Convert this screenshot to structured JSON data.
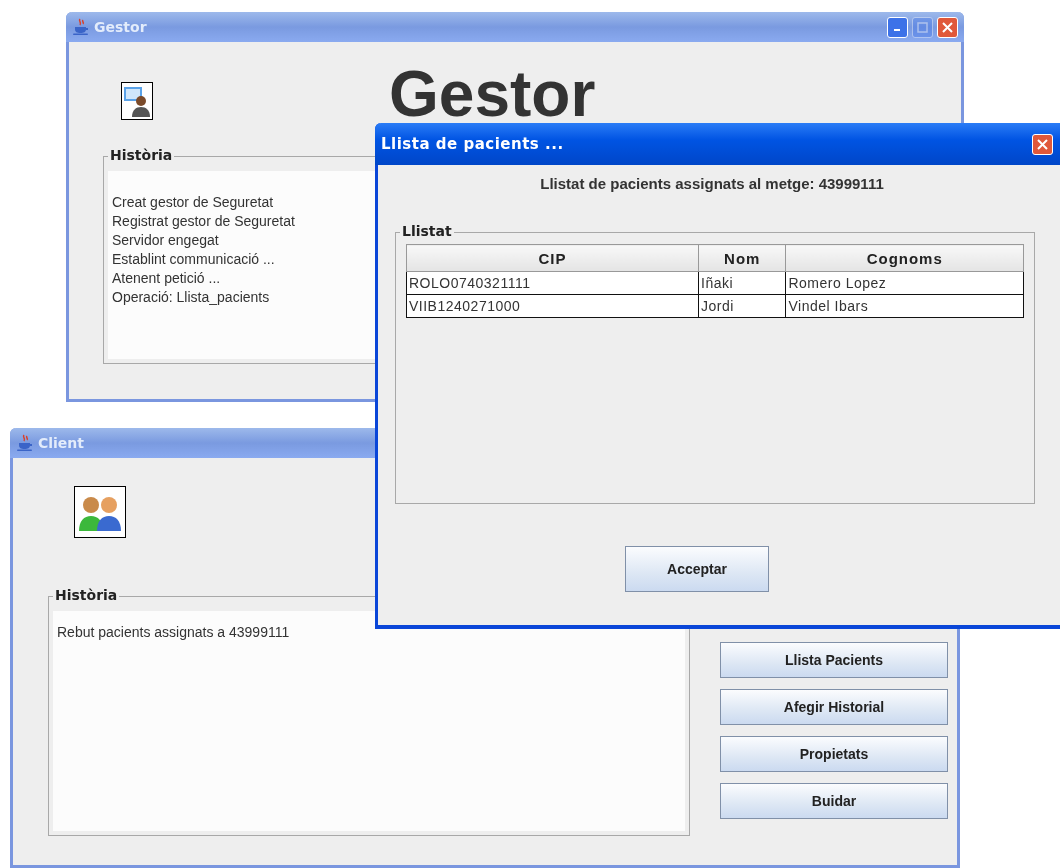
{
  "gestor_window": {
    "title": "Gestor",
    "active": false,
    "maximize_disabled": true,
    "heading": "Gestor",
    "history": {
      "label": "Història",
      "lines": [
        "Creat gestor de Seguretat",
        "Registrat gestor de Seguretat",
        "Servidor engegat",
        "Establint communicació ...",
        "Atenent petició ...",
        "Operació: Llista_pacients"
      ]
    }
  },
  "client_window": {
    "title": "Client",
    "active": false,
    "history": {
      "label": "Història",
      "lines": [
        "Rebut pacients assignats a 43999111"
      ]
    },
    "buttons": [
      "Llista Pacients",
      "Afegir Historial",
      "Propietats",
      "Buidar"
    ]
  },
  "dialog": {
    "title": "Llista de pacients ...",
    "active": true,
    "message": "Llistat de pacients assignats al metge: 43999111",
    "group_label": "Llistat",
    "table": {
      "columns": [
        "CIP",
        "Nom",
        "Cognoms"
      ],
      "rows": [
        [
          "ROLO0740321111",
          "Iñaki",
          "Romero Lopez"
        ],
        [
          "VIIB1240271000",
          "Jordi",
          "Vindel Ibars"
        ]
      ]
    },
    "button": "Acceptar"
  }
}
